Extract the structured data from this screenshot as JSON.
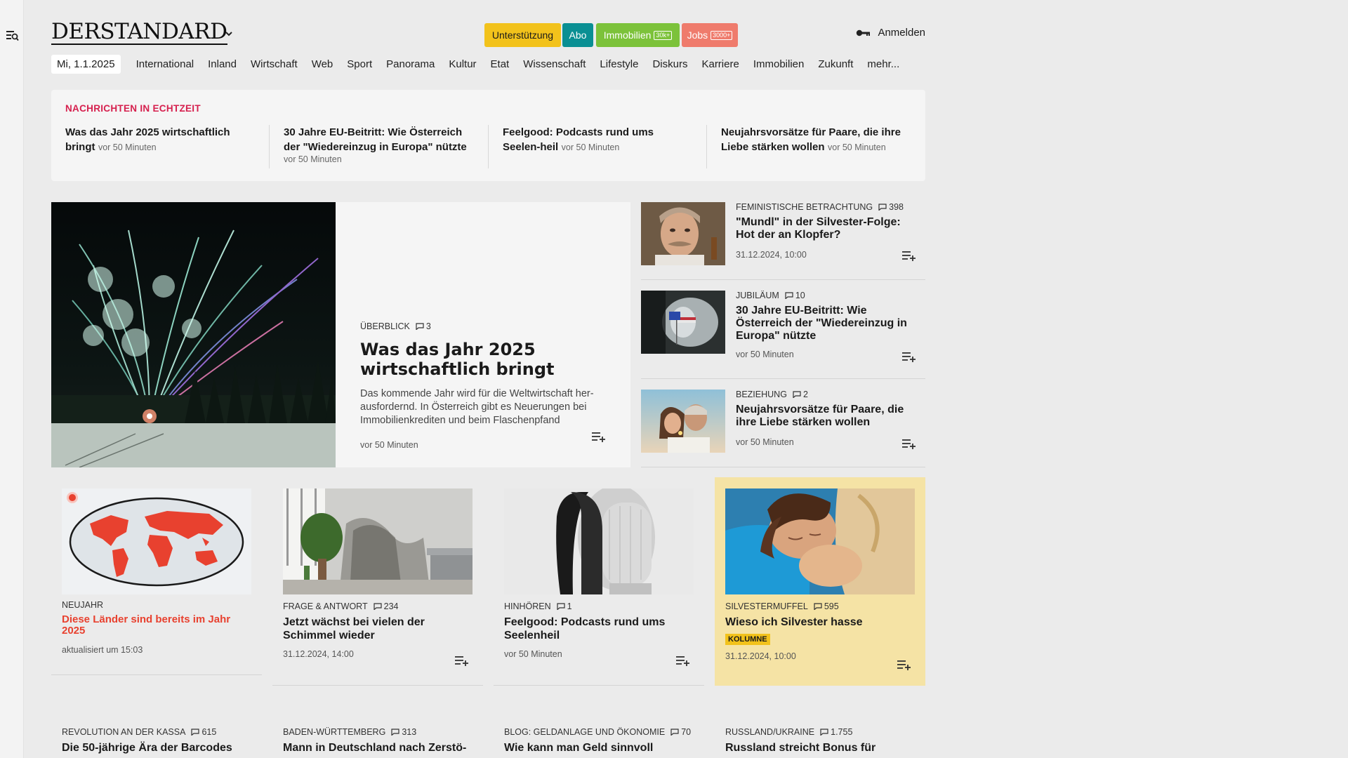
{
  "header": {
    "logo": "DERSTANDARD",
    "promos": [
      {
        "label": "Unterstützung",
        "chip": ""
      },
      {
        "label": "Abo",
        "chip": ""
      },
      {
        "label": "Immobilien",
        "chip": "30k+"
      },
      {
        "label": "Jobs",
        "chip": "3000+"
      }
    ],
    "login_label": "Anmelden"
  },
  "nav": {
    "date": "Mi, 1.1.2025",
    "items": [
      "International",
      "Inland",
      "Wirtschaft",
      "Web",
      "Sport",
      "Panorama",
      "Kultur",
      "Etat",
      "Wissenschaft",
      "Lifestyle",
      "Diskurs",
      "Karriere",
      "Immobilien",
      "Zukunft",
      "mehr..."
    ]
  },
  "ticker": {
    "label": "NACHRICHTEN IN ECHTZEIT",
    "items": [
      {
        "title": "Was das Jahr 2025 wirtschaftlich bringt",
        "time": "vor 50 Minuten"
      },
      {
        "title": "30 Jahre EU-Beitritt: Wie Österreich der \"Wiedereinzug in Europa\" nützte",
        "time": "vor 50 Minuten"
      },
      {
        "title": "Feelgood: Podcasts rund ums Seelen-heil",
        "time": "vor 50 Minuten"
      },
      {
        "title": "Neujahrsvorsätze für Paare, die ihre Liebe stärken wollen",
        "time": "vor 50 Minuten"
      }
    ]
  },
  "hero": {
    "kicker": "ÜBERBLICK",
    "comments": "3",
    "title": "Was das Jahr 2025 wirtschaftlich bringt",
    "teaser": "Das kommende Jahr wird für die Weltwirtschaft her-ausfordernd. In Österreich gibt es Neuerungen bei Immobilienkrediten und beim Flaschenpfand",
    "time": "vor 50 Minuten"
  },
  "side": [
    {
      "kicker": "FEMINISTISCHE BETRACHTUNG",
      "comments": "398",
      "title": "\"Mundl\" in der Silvester-Folge: Hot der an Klopfer?",
      "time": "31.12.2024, 10:00"
    },
    {
      "kicker": "JUBILÄUM",
      "comments": "10",
      "title": "30 Jahre EU-Beitritt: Wie Österreich der \"Wiedereinzug in Europa\" nützte",
      "time": "vor 50 Minuten"
    },
    {
      "kicker": "BEZIEHUNG",
      "comments": "2",
      "title": "Neujahrsvorsätze für Paare, die ihre Liebe stärken wollen",
      "time": "vor 50 Minuten"
    }
  ],
  "grid": [
    {
      "kicker": "NEUJAHR",
      "comments": "",
      "title": "Diese Länder sind bereits im Jahr 2025",
      "time": "aktualisiert um 15:03",
      "badge": ""
    },
    {
      "kicker": "FRAGE & ANTWORT",
      "comments": "234",
      "title": "Jetzt wächst bei vielen der Schimmel wieder",
      "time": "31.12.2024, 14:00",
      "badge": ""
    },
    {
      "kicker": "HINHÖREN",
      "comments": "1",
      "title": "Feelgood: Podcasts rund ums Seelenheil",
      "time": "vor 50 Minuten",
      "badge": ""
    },
    {
      "kicker": "SILVESTERMUFFEL",
      "comments": "595",
      "title": "Wieso ich Silvester hasse",
      "time": "31.12.2024, 10:00",
      "badge": "KOLUMNE"
    }
  ],
  "bottom": [
    {
      "kicker": "REVOLUTION AN DER KASSA",
      "comments": "615",
      "title": "Die 50-jährige Ära der Barcodes"
    },
    {
      "kicker": "BADEN-WÜRTTEMBERG",
      "comments": "313",
      "title": "Mann in Deutschland nach Zerstö-"
    },
    {
      "kicker": "BLOG: GELDANLAGE UND ÖKONOMIE",
      "comments": "70",
      "title": "Wie kann man Geld sinnvoll"
    },
    {
      "kicker": "RUSSLAND/UKRAINE",
      "comments": "1.755",
      "title": "Russland streicht Bonus für"
    }
  ],
  "colors": {
    "accent_red": "#d6204e",
    "promo_yellow": "#f2c21b",
    "promo_teal": "#0a8f93",
    "promo_green": "#7cc23a",
    "promo_salmon": "#ef7b6c",
    "column_highlight": "#f5e3a5"
  }
}
